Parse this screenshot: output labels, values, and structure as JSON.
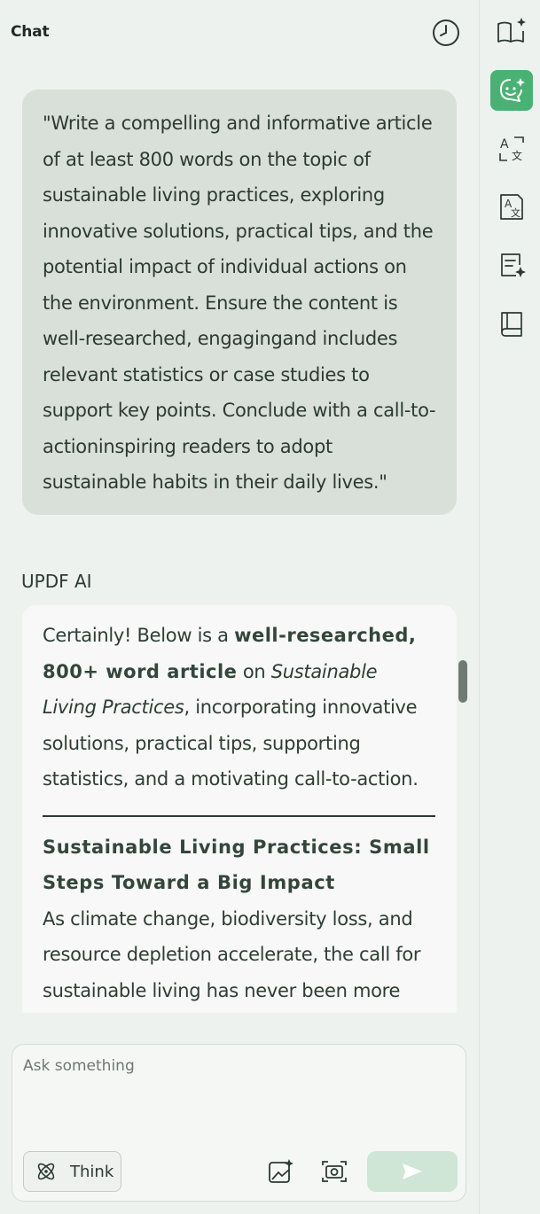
{
  "header": {
    "title": "Chat",
    "history_icon": "clock-icon"
  },
  "user_message": {
    "text": "\"Write a compelling and informative article of at least 800 words on the topic of sustainable living practices, exploring innovative solutions, practical tips, and the potential impact of individual actions on the environment. Ensure the content is well-researched, engagingand includes relevant statistics or case studies to support key points. Conclude with a call-to-actioninspiring readers to adopt sustainable habits in their daily lives.\""
  },
  "ai_reply": {
    "sender": "UPDF AI",
    "intro_prefix": "Certainly! Below is a ",
    "intro_bold": "well-researched, 800+ word article",
    "intro_mid": " on ",
    "intro_italic": "Sustainable Living Practices",
    "intro_suffix": ", incorporating innovative solutions, practical tips, supporting statistics, and a motivating call-to-action.",
    "heading": "Sustainable Living Practices: Small Steps Toward a Big Impact",
    "body_start": "As climate change, biodiversity loss, and resource depletion accelerate, the call for sustainable living has never been more"
  },
  "input": {
    "placeholder": "Ask something",
    "think_label": "Think",
    "think_icon": "atom-icon",
    "image_icon": "image-sparkle-icon",
    "camera_icon": "camera-icon",
    "send_icon": "send-icon"
  },
  "rail": {
    "items": [
      {
        "name": "book-sparkle-icon",
        "active": false
      },
      {
        "name": "chat-bot-icon",
        "active": true
      },
      {
        "name": "translate-icon",
        "active": false
      },
      {
        "name": "translate-box-icon",
        "active": false
      },
      {
        "name": "summary-sparkle-icon",
        "active": false
      },
      {
        "name": "book-icon",
        "active": false
      }
    ]
  },
  "colors": {
    "accent": "#49b174",
    "send_bg": "#cfe5d5",
    "user_bubble": "#d9e0d9",
    "ai_bubble": "#f7f8f7"
  }
}
